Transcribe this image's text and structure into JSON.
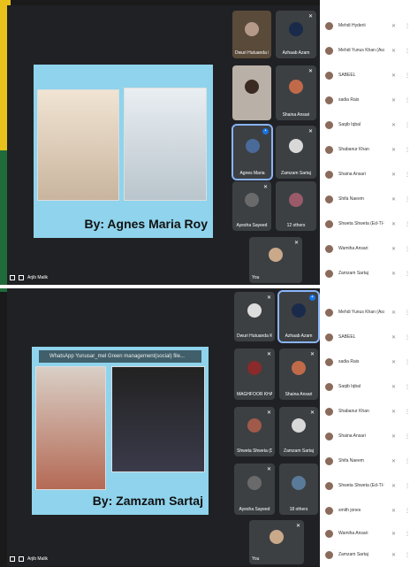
{
  "top": {
    "presenter": "Arjib Malik",
    "slide_caption": "By: Agnes Maria Roy",
    "tiles": [
      {
        "name": "Dwuri Hutuanda K..."
      },
      {
        "name": "Azhaab Azam"
      },
      {
        "name": ""
      },
      {
        "name": "Shaina Ansari"
      },
      {
        "name": "Agnes Maria"
      },
      {
        "name": "Zamzam Sartaj"
      },
      {
        "name": "Ayesha Sayeed"
      },
      {
        "name": "12 others"
      },
      {
        "name": "You"
      }
    ],
    "participants": [
      "Mehdi Hyderii",
      "Mehdi Yunus Khan (Assist...",
      "SABEEL",
      "sadia Rais",
      "Saqib Iqbal",
      "Shabanur Khan",
      "Shaina Ansari",
      "Shifa Naeem",
      "Shweta Shweta (Ed-TI-VI)",
      "Wamiha Ansari",
      "Zamzam Sartaj"
    ]
  },
  "bottom": {
    "presenter": "Arjib Malik",
    "banner": "WhatsApp Yunusar_mel Green management(social) file...",
    "slide_caption": "By: Zamzam Sartaj",
    "tiles": [
      {
        "name": "Dwuri Hutuanda Kh..."
      },
      {
        "name": "Azhaab Azam"
      },
      {
        "name": "MAGHFOOR KHAN"
      },
      {
        "name": "Shaina Ansari"
      },
      {
        "name": "Shweta Shweta (D..."
      },
      {
        "name": "Zamzam Sartaj"
      },
      {
        "name": "Ayesha Sayeed"
      },
      {
        "name": "18 others"
      },
      {
        "name": "You"
      }
    ],
    "participants": [
      "Mehdi Yunus Khan (Assist...",
      "SABEEL",
      "sadia Rais",
      "Saqib Iqbal",
      "Shabanur Khan",
      "Shaina Ansari",
      "Shifa Naeem",
      "Shweta Shweta (Ed-TI-VI)",
      "smith jones",
      "Wamiha Ansari",
      "Zamzam Sartaj"
    ]
  },
  "icons": {
    "mic_off": "mic-off-icon",
    "more": "more-vert-icon",
    "pin": "pin-icon"
  }
}
